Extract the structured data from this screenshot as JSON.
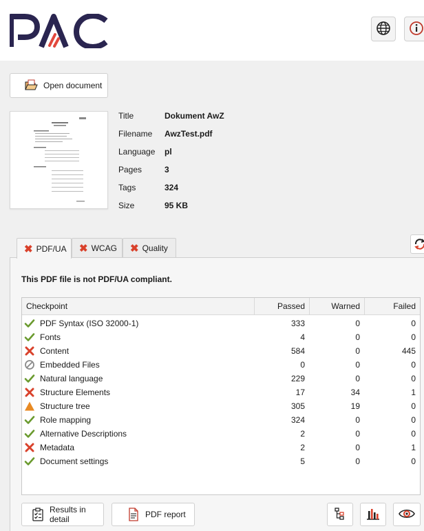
{
  "app": {
    "logo_text": "PAC"
  },
  "header": {
    "language_icon": "globe-icon",
    "info_icon": "info-icon"
  },
  "open_document": {
    "label": "Open document"
  },
  "properties": [
    {
      "label": "Title",
      "value": "Dokument AwZ"
    },
    {
      "label": "Filename",
      "value": "AwzTest.pdf"
    },
    {
      "label": "Language",
      "value": "pl"
    },
    {
      "label": "Pages",
      "value": "3"
    },
    {
      "label": "Tags",
      "value": "324"
    },
    {
      "label": "Size",
      "value": "95 KB"
    }
  ],
  "tabs": [
    {
      "label": "PDF/UA",
      "status": "fail",
      "active": true
    },
    {
      "label": "WCAG",
      "status": "fail",
      "active": false
    },
    {
      "label": "Quality",
      "status": "fail",
      "active": false
    }
  ],
  "result": {
    "message": "This PDF file is not PDF/UA compliant."
  },
  "table": {
    "headers": {
      "checkpoint": "Checkpoint",
      "passed": "Passed",
      "warned": "Warned",
      "failed": "Failed"
    },
    "rows": [
      {
        "status": "pass",
        "name": "PDF Syntax (ISO 32000-1)",
        "passed": "333",
        "warned": "0",
        "failed": "0"
      },
      {
        "status": "pass",
        "name": "Fonts",
        "passed": "4",
        "warned": "0",
        "failed": "0"
      },
      {
        "status": "fail",
        "name": "Content",
        "passed": "584",
        "warned": "0",
        "failed": "445"
      },
      {
        "status": "na",
        "name": "Embedded Files",
        "passed": "0",
        "warned": "0",
        "failed": "0"
      },
      {
        "status": "pass",
        "name": "Natural language",
        "passed": "229",
        "warned": "0",
        "failed": "0"
      },
      {
        "status": "fail",
        "name": "Structure Elements",
        "passed": "17",
        "warned": "34",
        "failed": "1"
      },
      {
        "status": "warn",
        "name": "Structure tree",
        "passed": "305",
        "warned": "19",
        "failed": "0"
      },
      {
        "status": "pass",
        "name": "Role mapping",
        "passed": "324",
        "warned": "0",
        "failed": "0"
      },
      {
        "status": "pass",
        "name": "Alternative Descriptions",
        "passed": "2",
        "warned": "0",
        "failed": "0"
      },
      {
        "status": "fail",
        "name": "Metadata",
        "passed": "2",
        "warned": "0",
        "failed": "1"
      },
      {
        "status": "pass",
        "name": "Document settings",
        "passed": "5",
        "warned": "0",
        "failed": "0"
      }
    ]
  },
  "footer": {
    "results_in_detail": "Results in detail",
    "pdf_report": "PDF report",
    "structure_icon": "structure-tree-icon",
    "statistics_icon": "bar-chart-icon",
    "preview_icon": "eye-icon"
  },
  "colors": {
    "pass": "#6a9a2e",
    "fail": "#d9412b",
    "warn": "#e88a24",
    "na": "#8a8a8a",
    "brand_dark": "#2a2550",
    "brand_red": "#e2483d"
  }
}
